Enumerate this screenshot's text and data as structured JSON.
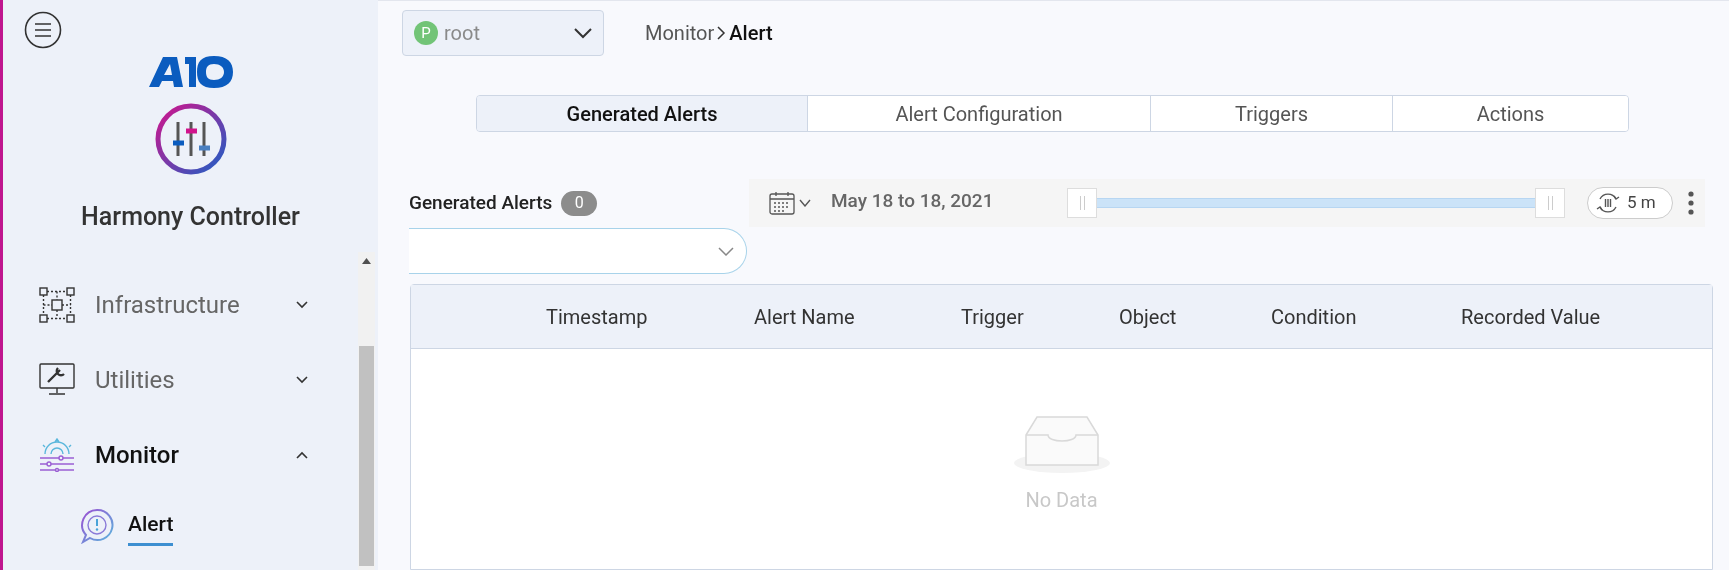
{
  "sidebar": {
    "product": "Harmony Controller",
    "items": [
      {
        "label": "Infrastructure",
        "kind": "infrastructure",
        "expanded": false,
        "selected": false
      },
      {
        "label": "Utilities",
        "kind": "utilities",
        "expanded": false,
        "selected": false
      },
      {
        "label": "Monitor",
        "kind": "monitor",
        "expanded": true,
        "selected": true,
        "children": [
          {
            "label": "Alert",
            "kind": "alert",
            "selected": true
          }
        ]
      }
    ]
  },
  "tenant": {
    "avatar": "P",
    "name": "root"
  },
  "breadcrumb": [
    {
      "label": "Monitor",
      "current": false
    },
    {
      "label": "Alert",
      "current": true
    }
  ],
  "tabs": [
    {
      "label": "Generated Alerts",
      "selected": true
    },
    {
      "label": "Alert Configuration",
      "selected": false
    },
    {
      "label": "Triggers",
      "selected": false
    },
    {
      "label": "Actions",
      "selected": false
    }
  ],
  "panel": {
    "title": "Generated Alerts",
    "count": "0",
    "date_range": "May 18 to 18, 2021",
    "range": {
      "level": 1
    },
    "refresh": "5 m"
  },
  "table": {
    "columns": [
      "Timestamp",
      "Alert Name",
      "Trigger",
      "Object",
      "Condition",
      "Recorded Value"
    ],
    "empty_text": "No Data"
  }
}
